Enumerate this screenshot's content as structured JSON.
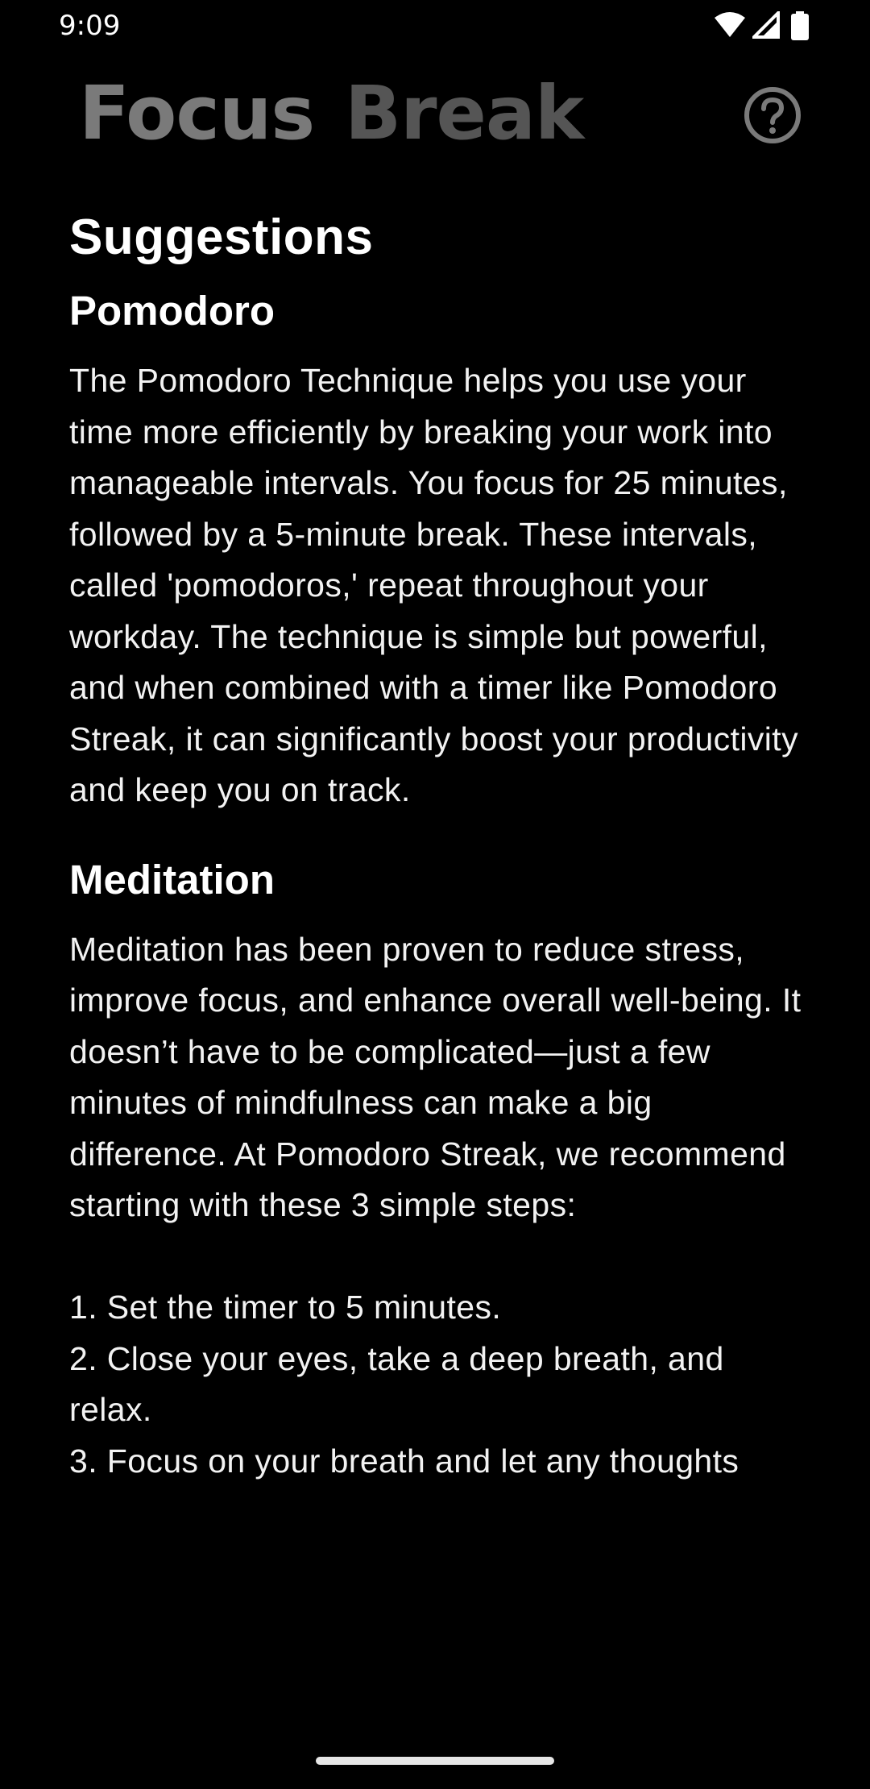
{
  "status_bar": {
    "time": "9:09",
    "icons": [
      "wifi-icon",
      "cellular-signal-icon",
      "battery-icon"
    ]
  },
  "header": {
    "tabs": [
      {
        "label": "Focus",
        "state": "inactive"
      },
      {
        "label": "Break",
        "state": "inactive"
      }
    ],
    "help_icon": "help-icon"
  },
  "content": {
    "title": "Suggestions",
    "sections": [
      {
        "title": "Pomodoro",
        "body": "The Pomodoro Technique helps you use your time more efficiently by breaking your work into manageable intervals. You focus for 25 minutes, followed by a 5-minute break. These intervals, called 'pomodoros,' repeat throughout your workday. The technique is simple but powerful, and when combined with a timer like Pomodoro Streak, it can significantly boost your productivity and keep you on track."
      },
      {
        "title": "Meditation",
        "body": "Meditation has been proven to reduce stress, improve focus, and enhance overall well-being. It doesn’t have to be complicated—just a few minutes of mindfulness can make a big difference. At Pomodoro Streak, we recommend starting with these 3 simple steps:\n\n1. Set the timer to 5 minutes.\n2. Close your eyes, take a deep breath, and relax.\n3. Focus on your breath and let any thoughts"
      }
    ]
  },
  "colors": {
    "background": "#000000",
    "text": "#ffffff",
    "tab_focus": "#7a7a7a",
    "tab_break": "#555555"
  }
}
